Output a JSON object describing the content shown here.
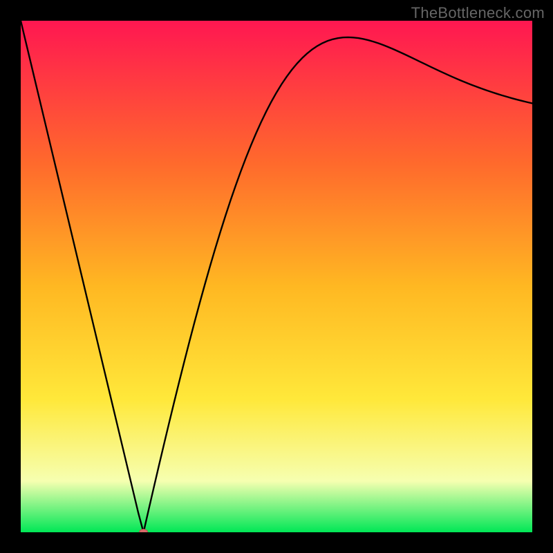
{
  "watermark": "TheBottleneck.com",
  "colors": {
    "frame": "#000000",
    "curve": "#000000",
    "marker_fill": "#d86a6a",
    "marker_stroke": "#b85252",
    "grad_top": "#ff1751",
    "grad_upper_mid": "#ff6a2c",
    "grad_mid": "#ffb822",
    "grad_lower_mid": "#ffe83a",
    "grad_pale": "#f6ffb0",
    "grad_bottom": "#00e756"
  },
  "chart_data": {
    "type": "line",
    "title": "",
    "xlabel": "",
    "ylabel": "",
    "xlim": [
      0,
      100
    ],
    "ylim": [
      0,
      100
    ],
    "x": [
      0,
      1,
      2,
      3,
      4,
      5,
      6,
      7,
      8,
      9,
      10,
      11,
      12,
      13,
      14,
      15,
      16,
      17,
      18,
      19,
      20,
      21,
      22,
      23,
      24,
      25,
      26,
      27,
      28,
      29,
      30,
      31,
      32,
      33,
      34,
      35,
      36,
      37,
      38,
      39,
      40,
      41,
      42,
      43,
      44,
      45,
      46,
      47,
      48,
      49,
      50,
      51,
      52,
      53,
      54,
      55,
      56,
      57,
      58,
      59,
      60,
      61,
      62,
      63,
      64,
      65,
      66,
      67,
      68,
      69,
      70,
      71,
      72,
      73,
      74,
      75,
      76,
      77,
      78,
      79,
      80,
      81,
      82,
      83,
      84,
      85,
      86,
      87,
      88,
      89,
      90,
      91,
      92,
      93,
      94,
      95,
      96,
      97,
      98,
      99,
      100
    ],
    "values": [
      100.0,
      95.81,
      91.63,
      87.44,
      83.26,
      79.07,
      74.88,
      70.7,
      66.51,
      62.33,
      58.14,
      53.95,
      49.77,
      45.58,
      41.4,
      37.21,
      33.02,
      28.84,
      24.65,
      20.47,
      16.28,
      12.09,
      7.91,
      3.72,
      0.0,
      4.37,
      8.7,
      12.98,
      17.2,
      21.37,
      25.48,
      29.52,
      33.48,
      37.37,
      41.17,
      44.88,
      48.48,
      51.99,
      55.38,
      58.65,
      61.81,
      64.84,
      67.74,
      70.51,
      73.14,
      75.64,
      77.99,
      80.2,
      82.27,
      84.19,
      85.97,
      87.6,
      89.08,
      90.42,
      91.62,
      92.68,
      93.61,
      94.41,
      95.08,
      95.63,
      96.06,
      96.38,
      96.6,
      96.73,
      96.77,
      96.72,
      96.61,
      96.43,
      96.19,
      95.9,
      95.57,
      95.2,
      94.8,
      94.37,
      93.92,
      93.46,
      92.99,
      92.51,
      92.02,
      91.54,
      91.06,
      90.58,
      90.11,
      89.65,
      89.2,
      88.76,
      88.33,
      87.92,
      87.52,
      87.14,
      86.77,
      86.42,
      86.08,
      85.75,
      85.44,
      85.15,
      84.86,
      84.59,
      84.33,
      84.09,
      83.85
    ],
    "minimum": {
      "x": 24,
      "y": 0
    }
  }
}
